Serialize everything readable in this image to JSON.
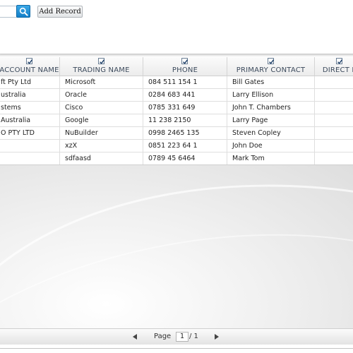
{
  "toolbar": {
    "search_value": "",
    "add_record_label": "Add Record"
  },
  "grid": {
    "columns": [
      {
        "title": "ACCOUNT NAME",
        "checked": true
      },
      {
        "title": "TRADING NAME",
        "checked": true
      },
      {
        "title": "PHONE",
        "checked": true
      },
      {
        "title": "PRIMARY CONTACT",
        "checked": true
      },
      {
        "title": "DIRECT L",
        "checked": true
      }
    ],
    "rows": [
      [
        "ft Pty Ltd",
        "Microsoft",
        "084 511 154  1",
        "Bill Gates",
        ""
      ],
      [
        "ustralia",
        "Oracle",
        "0284 683 441",
        "Larry Ellison",
        ""
      ],
      [
        "stems",
        "Cisco",
        "0785 331 649",
        "John T. Chambers",
        ""
      ],
      [
        "Australia",
        "Google",
        "11 238 2150",
        "Larry Page",
        ""
      ],
      [
        "O PTY LTD",
        "NuBuilder",
        "0998 2465 135",
        "Steven Copley",
        ""
      ],
      [
        "",
        "xzX",
        "0851 223 64 1",
        "John Doe",
        ""
      ],
      [
        "",
        "sdfaasd",
        "0789 45 6464",
        "Mark Tom",
        ""
      ]
    ]
  },
  "pager": {
    "page_label": "Page",
    "current_page": "1",
    "total_label": "/ 1"
  },
  "colors": {
    "accent": "#1f8fd8",
    "header_text": "#3c4a5c"
  }
}
